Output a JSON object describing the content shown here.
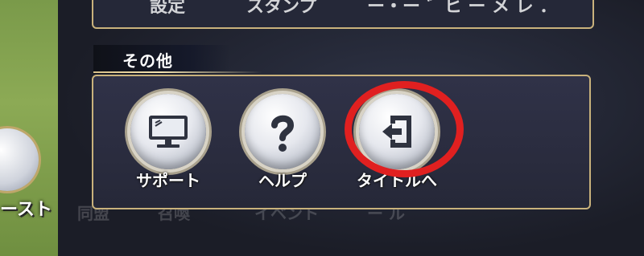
{
  "top_panel": {
    "left_text": "設定",
    "mid_text": "スタンプ",
    "right_text": "ー・ー ゛ヒ ー メ レ ．"
  },
  "left_badge": {
    "label": "ースト"
  },
  "ghost_row": {
    "text": "同盟　　　召喚　　　　イベント　　　ー ル"
  },
  "section": {
    "title": "その他"
  },
  "items": [
    {
      "label": "サポート",
      "icon": "monitor-icon"
    },
    {
      "label": "ヘルプ",
      "icon": "question-icon"
    },
    {
      "label": "タイトルへ",
      "icon": "exit-to-title-icon"
    }
  ],
  "highlight": {
    "color": "#e02020"
  }
}
